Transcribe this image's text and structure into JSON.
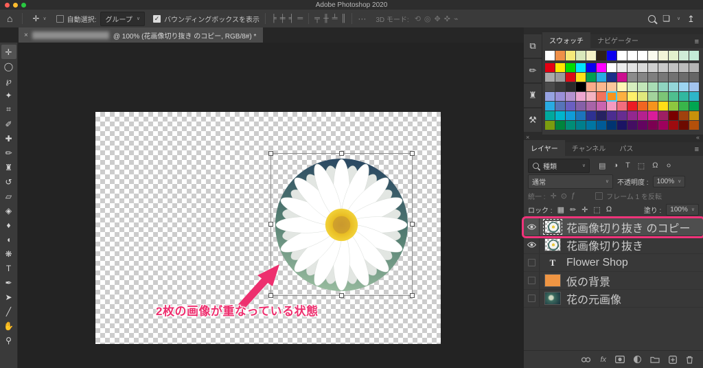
{
  "titlebar": {
    "title": "Adobe Photoshop 2020"
  },
  "options_bar": {
    "home_icon": "⌂",
    "move_icon": "✛",
    "auto_select_label": "自動選択:",
    "group_dropdown_value": "グループ",
    "bbox_checkbox_label": "バウンディングボックスを表示",
    "check_glyph": "✓",
    "align_icons": [
      "╞",
      "╪",
      "╡",
      "═"
    ],
    "distribute_icons": [
      "╤",
      "╫",
      "╧",
      "║"
    ],
    "more_options": "···",
    "mode3d_label": "3D モード:",
    "mode3d_icons": [
      "⟲",
      "◎",
      "✥",
      "✜",
      "⌁"
    ],
    "workspace_icon": "❏",
    "share_icon": "↥"
  },
  "document_tab": {
    "close_glyph": "×",
    "title_suffix": "@ 100% (花画像切り抜き のコピー, RGB/8#) *"
  },
  "tools": [
    {
      "name": "move-tool",
      "glyph": "✛",
      "selected": true
    },
    {
      "name": "marquee-tool",
      "glyph": "◯"
    },
    {
      "name": "lasso-tool",
      "glyph": "℘"
    },
    {
      "name": "magic-wand-tool",
      "glyph": "✦"
    },
    {
      "name": "crop-tool",
      "glyph": "⌗"
    },
    {
      "name": "eyedropper-tool",
      "glyph": "✐"
    },
    {
      "name": "healing-brush-tool",
      "glyph": "✚"
    },
    {
      "name": "brush-tool",
      "glyph": "✏"
    },
    {
      "name": "clone-stamp-tool",
      "glyph": "♜"
    },
    {
      "name": "history-brush-tool",
      "glyph": "↺"
    },
    {
      "name": "eraser-tool",
      "glyph": "▱"
    },
    {
      "name": "gradient-tool",
      "glyph": "◈"
    },
    {
      "name": "blur-tool",
      "glyph": "♦"
    },
    {
      "name": "dodge-tool",
      "glyph": "◖"
    },
    {
      "name": "smudge-tool",
      "glyph": "❋"
    },
    {
      "name": "type-tool",
      "glyph": "T"
    },
    {
      "name": "pen-tool",
      "glyph": "✒"
    },
    {
      "name": "path-selection-tool",
      "glyph": "➤"
    },
    {
      "name": "line-tool",
      "glyph": "╱"
    },
    {
      "name": "hand-tool",
      "glyph": "✋"
    },
    {
      "name": "zoom-tool",
      "glyph": "⚲"
    }
  ],
  "canvas": {
    "annotation_text": "2枚の画像が重なっている状態",
    "annotation_color": "#ed2f6e"
  },
  "panels": {
    "collapsed_icons": [
      {
        "name": "history-panel-icon",
        "glyph": "⧉"
      },
      {
        "name": "brush-settings-panel-icon",
        "glyph": "✏"
      },
      {
        "name": "clone-source-panel-icon",
        "glyph": "♜"
      },
      {
        "name": "tool-presets-panel-icon",
        "glyph": "⚒"
      }
    ],
    "swatches": {
      "tabs": [
        "スウォッチ",
        "ナビゲーター"
      ],
      "menu_icon": "≡",
      "recent_row": [
        "#ffffff",
        "#f09048",
        "#f6e97a",
        "#d9e8bb",
        "#f6f2c6",
        "#2e2218",
        "#0b00ee",
        "#ffffff",
        "#ffffff",
        "#ffffff",
        "#fbfbef",
        "#f3f5d8",
        "#e2f0cd",
        "#d0ecd8",
        "#c4ead8"
      ],
      "grid": [
        [
          "#e60012",
          "#ffe600",
          "#00dc00",
          "#00e5ff",
          "#0a00f0",
          "#ff00ff",
          "#ffffff",
          "#ececec",
          "#e3e3e3",
          "#dadada",
          "#d0d0d0",
          "#c9c9c9",
          "#c2c2c2",
          "#bcbcbc",
          "#b5b5b5"
        ],
        [
          "#aaaaaa",
          "#9b9b9b",
          "#dd0b16",
          "#ffe11a",
          "#00a053",
          "#29abe2",
          "#1b2f8a",
          "#cc0e8f",
          "#8c8c8c",
          "#858585",
          "#7f7f7f",
          "#787878",
          "#727272",
          "#6c6c6c",
          "#666666"
        ],
        [
          "#4a4a4a",
          "#3a3a3a",
          "#2a2a2a",
          "#000000",
          "#fcab8a",
          "#fbb88f",
          "#fcc79b",
          "#fff6b5",
          "#d6eebe",
          "#c2e6b8",
          "#a8dcb4",
          "#8fd4c0",
          "#93d6d8",
          "#9cd4f0",
          "#a3c4ee"
        ],
        [
          "#96a2e2",
          "#9a8fd8",
          "#b492cf",
          "#eda6cf",
          "#f4b3c2",
          "#f3735c",
          "#f7941d",
          "#fbb040",
          "#fdf06a",
          "#e0e97c",
          "#a3d39c",
          "#7cc576",
          "#4fbf8f",
          "#31b8a0",
          "#2eb6c9"
        ],
        [
          "#29abe2",
          "#5674b9",
          "#6a5fc1",
          "#8560a8",
          "#a864a8",
          "#c964b0",
          "#f49ac1",
          "#f26d7d",
          "#ed1c24",
          "#f26522",
          "#f7941d",
          "#ffde17",
          "#8dc63f",
          "#39b54a",
          "#00a651"
        ],
        [
          "#00a99d",
          "#00b5cc",
          "#0f9cd8",
          "#1c75bc",
          "#2e3192",
          "#262262",
          "#4b2d90",
          "#662d91",
          "#92278f",
          "#b5208f",
          "#da1c9a",
          "#9e1f63",
          "#790000",
          "#a0410d",
          "#c8910b"
        ],
        [
          "#7a9c0f",
          "#00843d",
          "#008d77",
          "#007f8c",
          "#0076a3",
          "#005b97",
          "#003471",
          "#1b1464",
          "#440e62",
          "#630460",
          "#7b0051",
          "#9e005d",
          "#9e0b0f",
          "#6d0a00",
          "#b4500a"
        ]
      ],
      "selected_cell": {
        "row": 3,
        "col": 6
      }
    },
    "layers": {
      "close_glyph": "×",
      "collapse_glyph": "«",
      "tabs": [
        "レイヤー",
        "チャンネル",
        "パス"
      ],
      "menu_icon": "≡",
      "filter_label": "種類",
      "filter_icons": [
        {
          "name": "filter-pixel-layers-icon",
          "glyph": "▤"
        },
        {
          "name": "filter-adjustment-layers-icon",
          "glyph": "◑"
        },
        {
          "name": "filter-type-layers-icon",
          "glyph": "T"
        },
        {
          "name": "filter-shape-layers-icon",
          "glyph": "⬚"
        },
        {
          "name": "filter-smart-objects-icon",
          "glyph": "Ω"
        },
        {
          "name": "filter-toggle-icon",
          "glyph": "⚪"
        }
      ],
      "blend_mode": "通常",
      "opacity_label": "不透明度 :",
      "opacity_value": "100%",
      "unify_label": "統一 :",
      "unify_icons": [
        "✛",
        "⊙",
        "ƒ"
      ],
      "frame_checkbox_label": "フレーム 1 を反転",
      "lock_label": "ロック :",
      "lock_icons": [
        "▦",
        "✏",
        "✛",
        "⬚",
        "Ω"
      ],
      "fill_label": "塗り :",
      "fill_value": "100%",
      "rows": [
        {
          "name": "花画像切り抜き のコピー",
          "visible": true,
          "selected": true,
          "highlighted": true,
          "thumb": "flower"
        },
        {
          "name": "花画像切り抜き",
          "visible": true,
          "thumb": "flower"
        },
        {
          "name": "Flower Shop",
          "visible": false,
          "thumb": "text"
        },
        {
          "name": "仮の背景",
          "visible": false,
          "thumb": "color",
          "thumb_color": "#ef9543"
        },
        {
          "name": "花の元画像",
          "visible": false,
          "thumb": "photo"
        }
      ],
      "bottom_icons": [
        "link-layers-icon",
        "layer-style-icon",
        "add-mask-icon",
        "adjustment-layer-icon",
        "new-group-icon",
        "new-layer-icon",
        "delete-layer-icon"
      ]
    }
  }
}
